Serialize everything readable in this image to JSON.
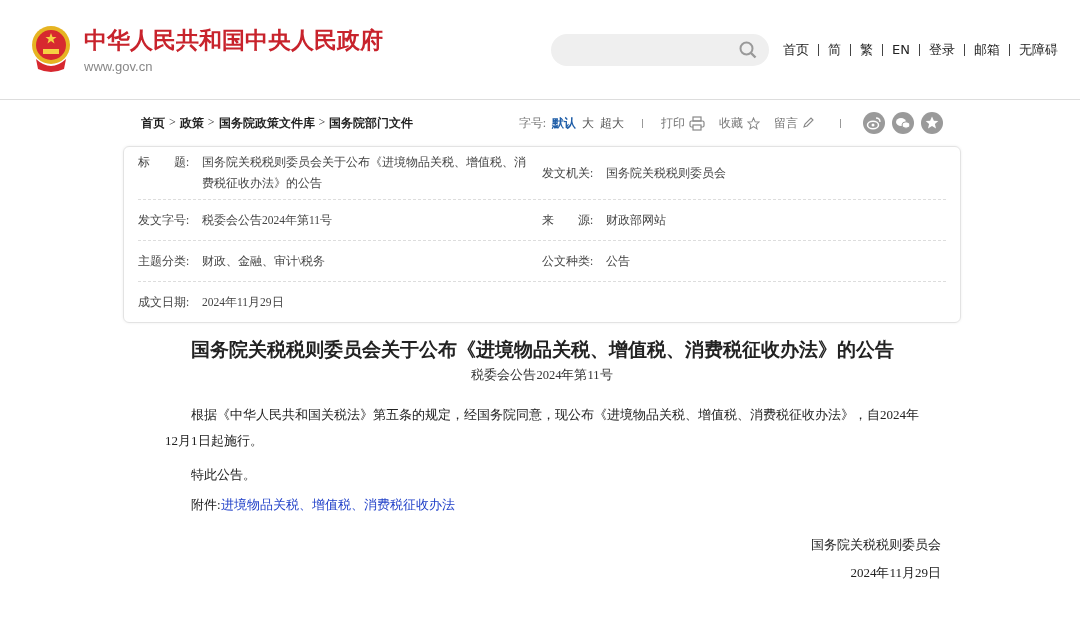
{
  "header": {
    "site_name": "中华人民共和国中央人民政府",
    "site_url": "www.gov.cn",
    "nav": [
      "首页",
      "简",
      "繁",
      "EN",
      "登录",
      "邮箱",
      "无障碍"
    ]
  },
  "breadcrumb": {
    "separator": ">",
    "items": [
      "首页",
      "政策",
      "国务院政策文件库",
      "国务院部门文件"
    ]
  },
  "toolbar": {
    "font_label": "字号:",
    "font_sizes": [
      {
        "label": "默认",
        "selected": true
      },
      {
        "label": "大",
        "selected": false
      },
      {
        "label": "超大",
        "selected": false
      }
    ],
    "actions": [
      {
        "label": "打印",
        "kind": "print"
      },
      {
        "label": "收藏",
        "kind": "star"
      },
      {
        "label": "留言",
        "kind": "pencil"
      }
    ],
    "share": [
      {
        "kind": "weibo"
      },
      {
        "kind": "wechat"
      },
      {
        "kind": "star"
      }
    ]
  },
  "meta": [
    [
      {
        "label": "标　　题:",
        "value": "国务院关税税则委员会关于公布《进境物品关税、增值税、消费税征收办法》的公告"
      },
      {
        "label": "发文机关:",
        "value": "国务院关税税则委员会"
      }
    ],
    [
      {
        "label": "发文字号:",
        "value": "税委会公告2024年第11号"
      },
      {
        "label": "来　　源:",
        "value": "财政部网站"
      }
    ],
    [
      {
        "label": "主题分类:",
        "value": "财政、金融、审计\\税务"
      },
      {
        "label": "公文种类:",
        "value": "公告"
      }
    ],
    [
      {
        "label": "成文日期:",
        "value": "2024年11月29日"
      }
    ]
  ],
  "article": {
    "title": "国务院关税税则委员会关于公布《进境物品关税、增值税、消费税征收办法》的公告",
    "doc_number": "税委会公告2024年第11号",
    "paragraphs": [
      "根据《中华人民共和国关税法》第五条的规定，经国务院同意，现公布《进境物品关税、增值税、消费税征收办法》，自2024年12月1日起施行。",
      "特此公告。"
    ],
    "attachment_label": "附件:",
    "attachment_link": "进境物品关税、增值税、消费税征收办法",
    "signature": "国务院关税税则委员会",
    "date": "2024年11月29日"
  }
}
